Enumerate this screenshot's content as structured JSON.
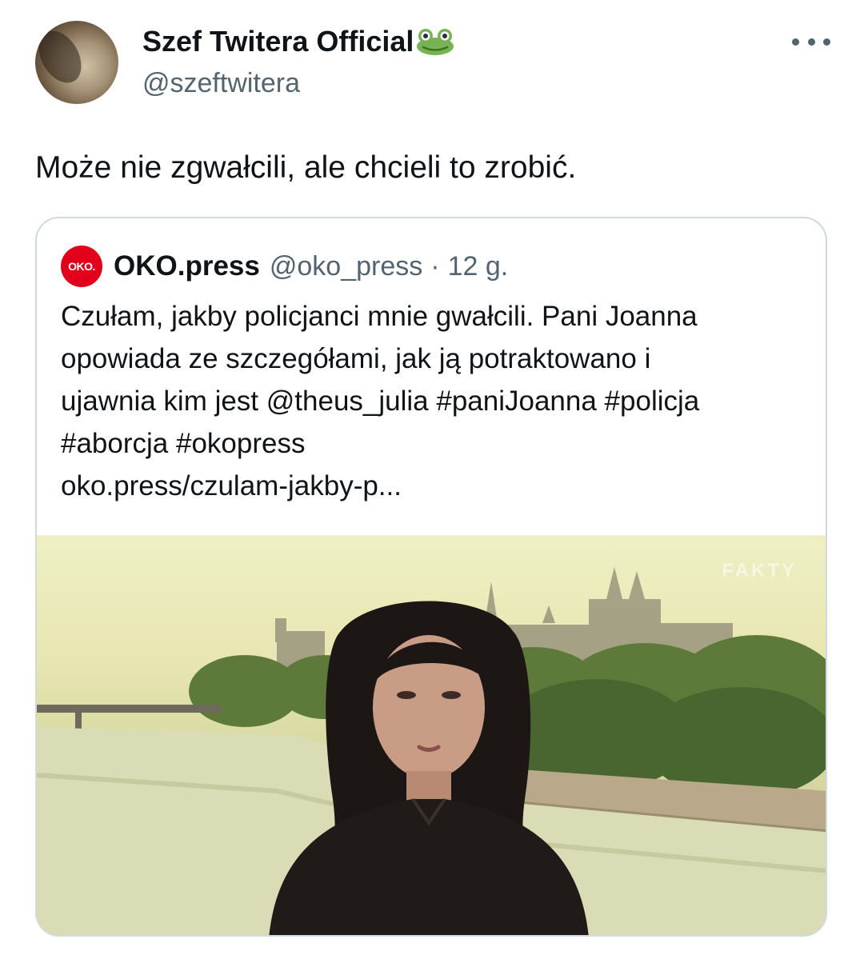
{
  "author": {
    "display_name": "Szef Twitera Official",
    "handle": "@szeftwitera",
    "badge_icon": "frog-icon"
  },
  "tweet": {
    "text": "Może nie zgwałcili, ale chcieli to zrobić."
  },
  "quoted": {
    "avatar_text": "OKO.",
    "avatar_color": "#e2001a",
    "name": "OKO.press",
    "handle": "@oko_press",
    "separator": "·",
    "time": "12 g.",
    "lines": [
      "Czułam, jakby policjanci mnie gwałcili. Pani Joanna",
      "opowiada ze szczegółami, jak ją potraktowano i",
      "ujawnia kim jest @theus_julia #paniJoanna #policja",
      "#aborcja #okopress",
      "oko.press/czulam-jakby-p..."
    ],
    "image_watermark": "FAKTY"
  },
  "colors": {
    "text": "#0f1419",
    "secondary": "#536471",
    "border": "#cfd9de"
  }
}
